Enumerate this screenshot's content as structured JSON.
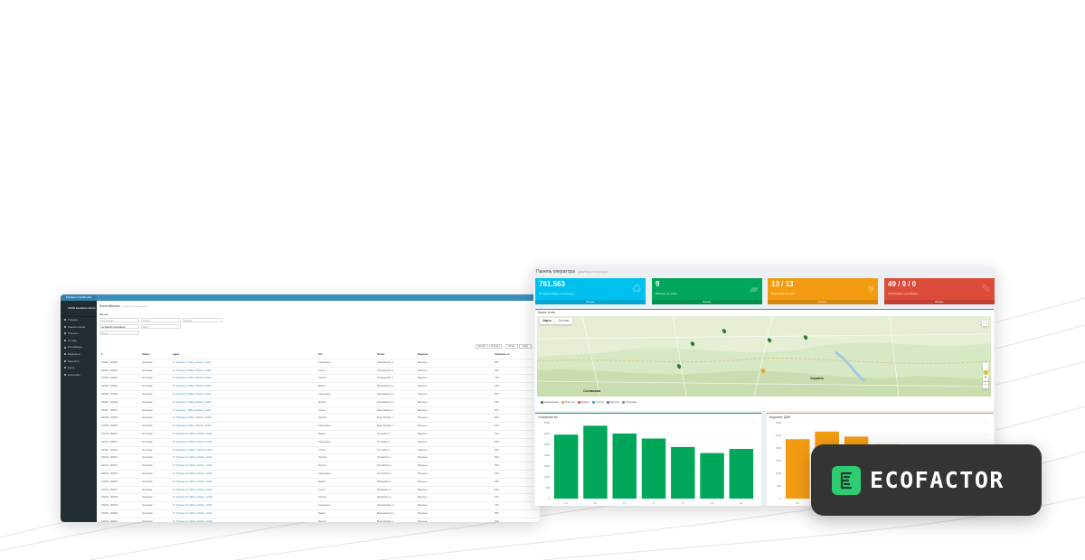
{
  "admin_window": {
    "brand": "Ecofactor Dashboard",
    "user": "ОКРЕ Ecofactor Admin",
    "sidebar_items": [
      "Главная",
      "Панель операт.",
      "Объекты",
      "Отходы",
      "Контейнеры",
      "Маршруты",
      "Водители",
      "Карта",
      "Настройки"
    ],
    "page_title": "Контейнеры",
    "page_subtitle": "список контейнеров",
    "filter_label": "Фильтр",
    "filters": [
      {
        "placeholder": "Тип отхода"
      },
      {
        "placeholder": "Статус"
      },
      {
        "placeholder": "Регион"
      },
      {
        "placeholder": "Активный/ неактивный"
      },
      {
        "placeholder": "Дата"
      },
      {
        "placeholder": "Поиск"
      }
    ],
    "table_buttons": [
      "Экспорт",
      "Колонки",
      "Печать",
      "Excel"
    ],
    "columns": [
      "#",
      "Объект",
      "Адрес",
      "Тип",
      "Регион",
      "Водитель",
      "Заполнено, %"
    ],
    "rows": [
      [
        "100001 - 000001",
        "Контейнер",
        "Ул. Приклад 1, Район, Область, 04123",
        "Смешанные",
        "Ужгородский р-н",
        "Водитель",
        "98%"
      ],
      [
        "100002 - 000002",
        "Контейнер",
        "Ул. Приклад 2, Район, Область, 04123",
        "Стекло",
        "Ужгородский р-н",
        "Водитель",
        "64%"
      ],
      [
        "100003 - 000003",
        "Контейнер",
        "Ул. Приклад 3, Район, Область, 04123",
        "Пластик",
        "Ужгородский р-н",
        "Водитель",
        "72%"
      ],
      [
        "100004 - 000004",
        "Контейнер",
        "Ул. Приклад 4, Район, Область, 04123",
        "Бумага",
        "Мукачевский р-н",
        "Водитель",
        "41%"
      ],
      [
        "100005 - 000005",
        "Контейнер",
        "Ул. Приклад 5, Район, Область, 04123",
        "Смешанные",
        "Мукачевский р-н",
        "Водитель",
        "85%"
      ],
      [
        "100006 - 000006",
        "Контейнер",
        "Ул. Приклад 6, Район, Область, 04123",
        "Металл",
        "Мукачевский р-н",
        "Водитель",
        "33%"
      ],
      [
        "100007 - 000007",
        "Контейнер",
        "Ул. Приклад 7, Район, Область, 04123",
        "Стекло",
        "Береговский р-н",
        "Водитель",
        "57%"
      ],
      [
        "100008 - 000008",
        "Контейнер",
        "Ул. Приклад 8, Район, Область, 04123",
        "Пластик",
        "Береговский р-н",
        "Водитель",
        "90%"
      ],
      [
        "100009 - 000009",
        "Контейнер",
        "Ул. Приклад 9, Район, Область, 04123",
        "Смешанные",
        "Береговский р-н",
        "Водитель",
        "46%"
      ],
      [
        "100010 - 000010",
        "Контейнер",
        "Ул. Приклад 10, Район, Область, 04123",
        "Бумага",
        "Хустский р-н",
        "Водитель",
        "78%"
      ],
      [
        "100011 - 000011",
        "Контейнер",
        "Ул. Приклад 11, Район, Область, 04123",
        "Смешанные",
        "Хустский р-н",
        "Водитель",
        "62%"
      ],
      [
        "100012 - 000012",
        "Контейнер",
        "Ул. Приклад 12, Район, Область, 04123",
        "Стекло",
        "Хустский р-н",
        "Водитель",
        "29%"
      ],
      [
        "100013 - 000013",
        "Контейнер",
        "Ул. Приклад 13, Район, Область, 04123",
        "Пластик",
        "Тячевский р-н",
        "Водитель",
        "81%"
      ],
      [
        "100014 - 000014",
        "Контейнер",
        "Ул. Приклад 14, Район, Область, 04123",
        "Металл",
        "Тячевский р-н",
        "Водитель",
        "54%"
      ],
      [
        "100015 - 000015",
        "Контейнер",
        "Ул. Приклад 15, Район, Область, 04123",
        "Смешанные",
        "Тячевский р-н",
        "Водитель",
        "67%"
      ],
      [
        "100016 - 000016",
        "Контейнер",
        "Ул. Приклад 16, Район, Область, 04123",
        "Бумага",
        "Раховский р-н",
        "Водитель",
        "38%"
      ],
      [
        "100017 - 000017",
        "Контейнер",
        "Ул. Приклад 17, Район, Область, 04123",
        "Стекло",
        "Раховский р-н",
        "Водитель",
        "92%"
      ],
      [
        "100018 - 000018",
        "Контейнер",
        "Ул. Приклад 18, Район, Область, 04123",
        "Пластик",
        "Раховский р-н",
        "Водитель",
        "49%"
      ],
      [
        "100019 - 000019",
        "Контейнер",
        "Ул. Приклад 19, Район, Область, 04123",
        "Смешанные",
        "Ужгородский р-н",
        "Водитель",
        "73%"
      ],
      [
        "100020 - 000020",
        "Контейнер",
        "Ул. Приклад 20, Район, Область, 04123",
        "Бумага",
        "Мукачевский р-н",
        "Водитель",
        "58%"
      ],
      [
        "100021 - 000021",
        "Контейнер",
        "Ул. Приклад 21, Район, Область, 04123",
        "Металл",
        "Береговский р-н",
        "Водитель",
        "44%"
      ],
      [
        "100022 - 000022",
        "Контейнер",
        "Ул. Приклад 22, Район, Область, 04123",
        "Смешанные",
        "Хустский р-н",
        "Водитель",
        "87%"
      ],
      [
        "100023 - 000023",
        "Контейнер",
        "Ул. Приклад 23, Район, Область, 04123",
        "Стекло",
        "Тячевский р-н",
        "Водитель",
        "61%"
      ],
      [
        "100024 - 000024",
        "Контейнер",
        "Ул. Приклад 24, Район, Область, 04123",
        "Пластик",
        "Раховский р-н",
        "Водитель",
        "35%"
      ]
    ]
  },
  "operator_window": {
    "title": "Панель оператора",
    "subtitle": "Дашборд оператора",
    "kpis": [
      {
        "value": "761.563",
        "label": "Отходов собрано в этом году, т",
        "footer": "Больше",
        "color": "#00c0ef",
        "icon": "recycle-icon"
      },
      {
        "value": "9",
        "label": "Машины на линии",
        "footer": "Больше",
        "color": "#00a65a",
        "icon": "truck-icon"
      },
      {
        "value": "13 / 13",
        "label": "Водителей на смене",
        "footer": "Больше",
        "color": "#f39c12",
        "icon": "handshake-icon"
      },
      {
        "value": "49 / 9 / 0",
        "label": "Проблемные контейнеры",
        "footer": "Больше",
        "color": "#dd4b39",
        "icon": "flame-icon"
      }
    ],
    "map": {
      "title": "Карта точек",
      "tab_map": "Карта",
      "tab_sat": "Спутник",
      "label_slovakia": "Словакия",
      "label_ukraine": "Україна",
      "legend": [
        "Смешанные",
        "Пластик",
        "Бумага",
        "Стекло",
        "Металл",
        "Органика"
      ],
      "legend_colors": [
        "#2e7d32",
        "#f39c12",
        "#e74c3c",
        "#3498db",
        "#8e44ad",
        "#7f8c8d"
      ],
      "zoom_in": "+",
      "zoom_out": "−"
    },
    "chart_left": {
      "title": "Собранные м3",
      "color": "#00a65a"
    },
    "chart_right": {
      "title": "Водители: ДИМ",
      "color": "#f39c12"
    }
  },
  "chart_data": [
    {
      "type": "bar",
      "title": "Собранные м3",
      "categories": [
        "Пн",
        "Вт",
        "Ср",
        "Чт",
        "Пт",
        "Сб",
        "Вс"
      ],
      "values": [
        2950,
        3360,
        3000,
        2770,
        2380,
        2100,
        2290
      ],
      "ylim": [
        0,
        3500
      ],
      "yticks": [
        0,
        500,
        1000,
        1500,
        2000,
        2500,
        3000,
        3500
      ]
    },
    {
      "type": "bar",
      "title": "Водители: ДИМ",
      "categories": [
        "Пн",
        "Вт",
        "Ср",
        "Чт",
        "Пт",
        "Сб",
        "Вс"
      ],
      "values": [
        2350,
        2650,
        2450,
        2150,
        1950,
        1900,
        1900
      ],
      "ylim": [
        0,
        3000
      ],
      "yticks": [
        0,
        500,
        1000,
        1500,
        2000,
        2500,
        3000
      ]
    }
  ],
  "badge": {
    "text": "ECOFACTOR",
    "logo_color": "#2ecc71"
  }
}
